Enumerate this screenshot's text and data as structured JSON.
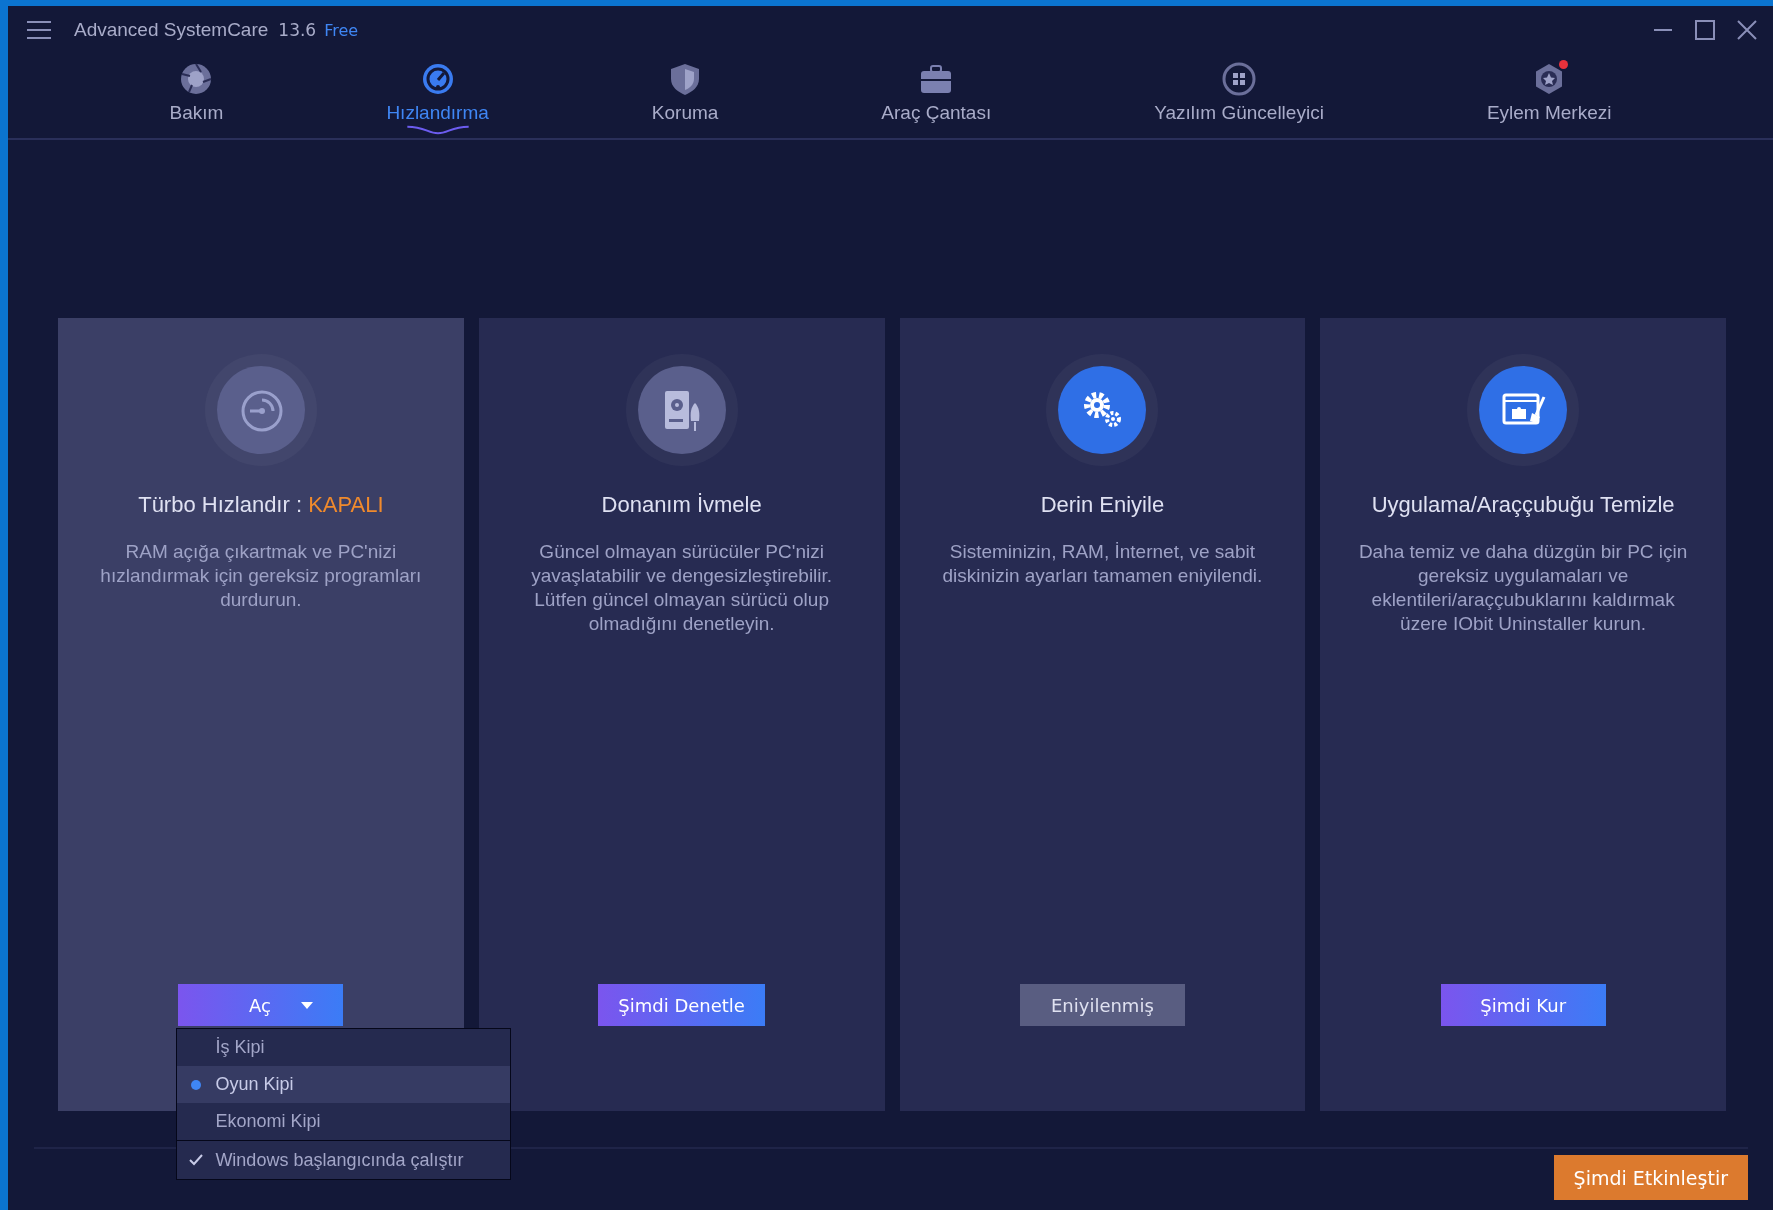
{
  "window": {
    "app_name": "Advanced SystemCare",
    "version": "13.6",
    "edition": "Free"
  },
  "tabs": [
    {
      "label": "Bakım",
      "selected": false,
      "badge": false
    },
    {
      "label": "Hızlandırma",
      "selected": true,
      "badge": false
    },
    {
      "label": "Koruma",
      "selected": false,
      "badge": false
    },
    {
      "label": "Araç Çantası",
      "selected": false,
      "badge": false
    },
    {
      "label": "Yazılım Güncelleyici",
      "selected": false,
      "badge": false
    },
    {
      "label": "Eylem Merkezi",
      "selected": false,
      "badge": true
    }
  ],
  "cards": [
    {
      "title": "Türbo Hızlandır : ",
      "status": "KAPALI",
      "active": false,
      "highlighted": true,
      "description": "RAM açığa çıkartmak ve PC'nizi hızlandırmak için gereksiz programları durdurun.",
      "button": {
        "label": "Aç",
        "kind": "split"
      }
    },
    {
      "title": "Donanım İvmele",
      "active": false,
      "highlighted": false,
      "description": "Güncel olmayan sürücüler PC'nizi yavaşlatabilir ve dengesizleştirebilir. Lütfen güncel olmayan sürücü olup olmadığını denetleyin.",
      "button": {
        "label": "Şimdi Denetle",
        "kind": "primary"
      }
    },
    {
      "title": "Derin Eniyile",
      "active": true,
      "highlighted": false,
      "description": "Sisteminizin, RAM, İnternet, ve sabit diskinizin ayarları tamamen eniyilendi.",
      "button": {
        "label": "Eniyilenmiş",
        "kind": "disabled"
      }
    },
    {
      "title": "Uygulama/Araççubuğu Temizle",
      "active": true,
      "highlighted": false,
      "description": "Daha temiz ve daha düzgün bir PC için gereksiz uygulamaları ve eklentileri/araççubuklarını kaldırmak üzere IObit Uninstaller kurun.",
      "button": {
        "label": "Şimdi Kur",
        "kind": "primary"
      }
    }
  ],
  "dropdown": {
    "items": [
      {
        "label": "İş Kipi",
        "kind": "radio",
        "selected": false
      },
      {
        "label": "Oyun Kipi",
        "kind": "radio",
        "selected": true
      },
      {
        "label": "Ekonomi Kipi",
        "kind": "radio",
        "selected": false
      },
      {
        "label": "Windows başlangıcında çalıştır",
        "kind": "check",
        "checked": true
      }
    ]
  },
  "activate_button": "Şimdi Etkinleştir"
}
